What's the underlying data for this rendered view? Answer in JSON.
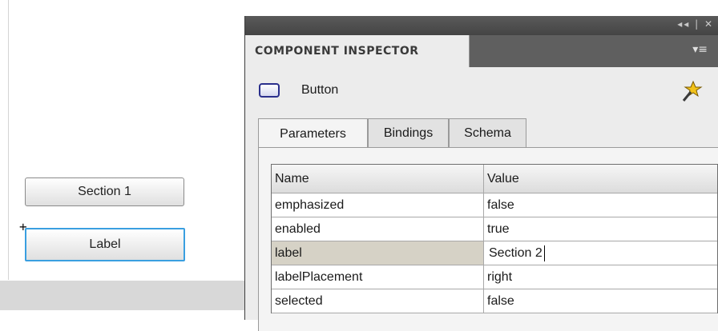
{
  "stage": {
    "buttons": [
      {
        "label": "Section 1"
      },
      {
        "label": "Label"
      }
    ]
  },
  "panel": {
    "controls": "◂◂ | ✕",
    "title": "COMPONENT INSPECTOR",
    "menu_icon": "panel-menu-icon",
    "component_name": "Button",
    "tabs": [
      {
        "label": "Parameters",
        "active": true
      },
      {
        "label": "Bindings",
        "active": false
      },
      {
        "label": "Schema",
        "active": false
      }
    ],
    "grid": {
      "columns": [
        "Name",
        "Value"
      ],
      "rows": [
        {
          "name": "emphasized",
          "value": "false"
        },
        {
          "name": "enabled",
          "value": "true"
        },
        {
          "name": "label",
          "value": "Section 2",
          "selected": true
        },
        {
          "name": "labelPlacement",
          "value": "right"
        },
        {
          "name": "selected",
          "value": "false"
        }
      ]
    }
  },
  "colors": {
    "selection_accent": "#3a9fe0",
    "panel_header": "#5f5f5f",
    "icon_border": "#2a2f8c"
  }
}
